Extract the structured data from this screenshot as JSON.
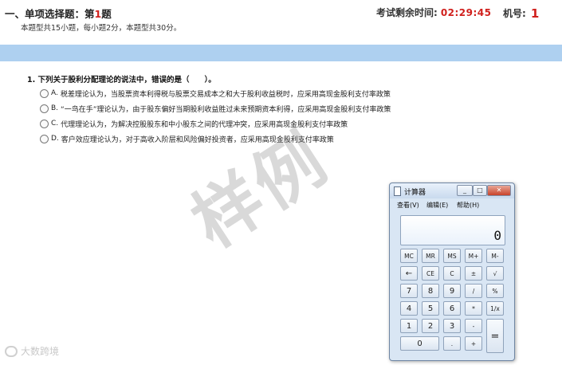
{
  "header": {
    "section_prefix": "一、单项选择题：第",
    "question_number": "1",
    "section_suffix": "题",
    "description": "本题型共15小题，每小题2分，本题型共30分。",
    "timer_label": "考试剩余时间:",
    "timer_value": "02:29:45",
    "machine_label": "机号:",
    "machine_value": "1"
  },
  "question": {
    "text": "1. 下列关于股利分配理论的说法中，错误的是（　　）。",
    "options": [
      {
        "letter": "A.",
        "text": "税差理论认为，当股票资本利得税与股票交易成本之和大于股利收益税时，应采用高现金股利支付率政策"
      },
      {
        "letter": "B.",
        "text": "“一鸟在手”理论认为，由于股东偏好当期股利收益胜过未来预期资本利得，应采用高现金股利支付率政策"
      },
      {
        "letter": "C.",
        "text": "代理理论认为，为解决控股股东和中小股东之间的代理冲突，应采用高现金股利支付率政策"
      },
      {
        "letter": "D.",
        "text": "客户效应理论认为，对于高收入阶层和风险偏好投资者，应采用高现金股利支付率政策"
      }
    ]
  },
  "watermark": "样例",
  "brand": "大数跨境",
  "calculator": {
    "title": "计算器",
    "menu": [
      "查看(V)",
      "编辑(E)",
      "帮助(H)"
    ],
    "display": "0",
    "keys": [
      [
        "MC",
        "MR",
        "MS",
        "M+",
        "M-"
      ],
      [
        "←",
        "CE",
        "C",
        "±",
        "√"
      ],
      [
        "7",
        "8",
        "9",
        "/",
        "%"
      ],
      [
        "4",
        "5",
        "6",
        "*",
        "1/x"
      ],
      [
        "1",
        "2",
        "3",
        "-",
        "="
      ],
      [
        "0",
        ".",
        "+"
      ]
    ]
  }
}
